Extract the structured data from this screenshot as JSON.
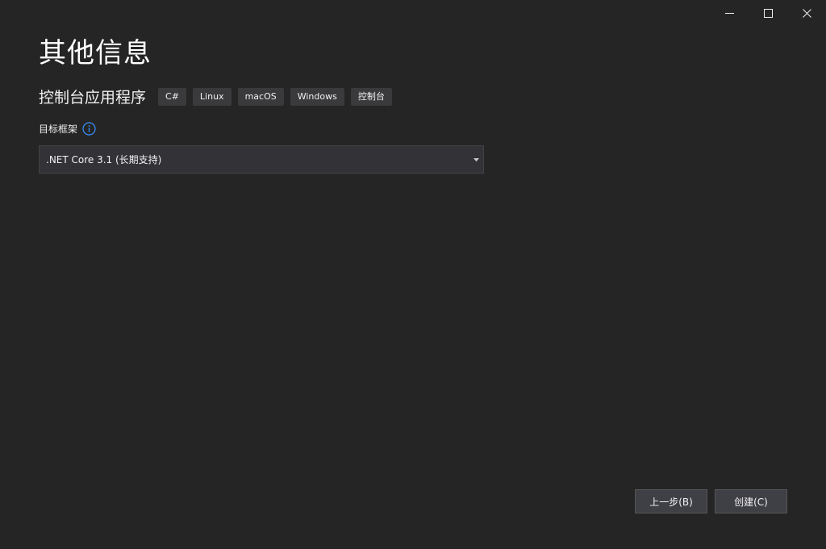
{
  "window": {
    "minimize_icon": "minimize-icon",
    "maximize_icon": "maximize-icon",
    "close_icon": "close-icon"
  },
  "header": {
    "title": "其他信息"
  },
  "template": {
    "name": "控制台应用程序",
    "tags": [
      "C#",
      "Linux",
      "macOS",
      "Windows",
      "控制台"
    ]
  },
  "framework": {
    "label": "目标框架",
    "info_icon": "info-icon",
    "selected": ".NET Core 3.1 (长期支持)"
  },
  "footer": {
    "back_label": "上一步(B)",
    "create_label": "创建(C)"
  },
  "colors": {
    "background": "#252526",
    "accent_info": "#3794ff",
    "button_bg": "#3f3f46",
    "input_bg": "#333337",
    "tag_bg": "#3a3a3d"
  }
}
